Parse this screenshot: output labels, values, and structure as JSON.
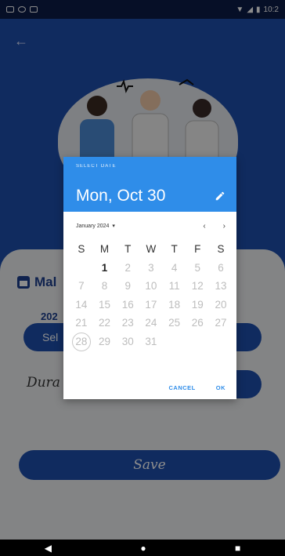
{
  "status_bar": {
    "time": "10:2"
  },
  "app": {
    "make_label": "Mal",
    "year_label": "202",
    "select_button_label": "Sel",
    "duration_label": "Dura",
    "save_label": "Save"
  },
  "date_picker": {
    "header_label": "SELECT DATE",
    "selected_date": "Mon, Oct 30",
    "month_label": "January 2024",
    "weekdays": [
      "S",
      "M",
      "T",
      "W",
      "T",
      "F",
      "S"
    ],
    "weeks": [
      [
        "",
        "1",
        "2",
        "3",
        "4",
        "5",
        "6"
      ],
      [
        "7",
        "8",
        "9",
        "10",
        "11",
        "12",
        "13"
      ],
      [
        "14",
        "15",
        "16",
        "17",
        "18",
        "19",
        "20"
      ],
      [
        "21",
        "22",
        "23",
        "24",
        "25",
        "26",
        "27"
      ],
      [
        "28",
        "29",
        "30",
        "31",
        "",
        "",
        ""
      ]
    ],
    "today_day": "1",
    "circled_day": "28",
    "cancel_label": "CANCEL",
    "ok_label": "OK"
  },
  "colors": {
    "primary": "#1e4fae",
    "dialog_header": "#2f8de9",
    "status_bar": "#0c1c48"
  }
}
